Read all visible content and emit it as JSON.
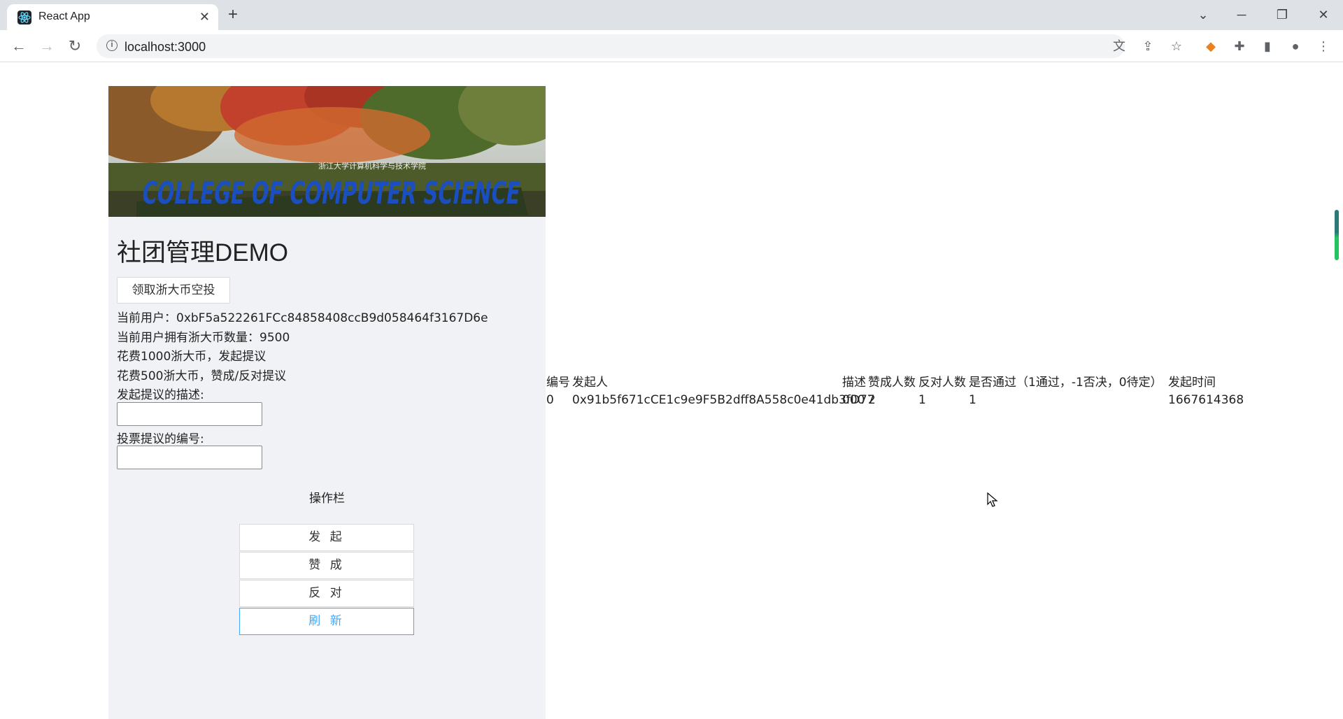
{
  "browser": {
    "tab_title": "React App",
    "url": "localhost:3000"
  },
  "app": {
    "title": "社团管理DEMO",
    "airdrop_button": "领取浙大币空投",
    "current_user": "当前用户：0xbF5a522261FCc84858408ccB9d058464f3167D6e",
    "balance": "当前用户拥有浙大币数量：9500",
    "cost_propose": "花费1000浙大币，发起提议",
    "cost_vote": "花费500浙大币，赞成/反对提议",
    "propose_desc_label": "发起提议的描述:",
    "vote_id_label": "投票提议的编号:",
    "ops_title": "操作栏",
    "buttons": {
      "propose": "发 起",
      "approve": "赞 成",
      "oppose": "反 对",
      "refresh": "刷 新"
    },
    "banner_text": "COLLEGE OF COMPUTER SCIENCE",
    "banner_subtext": "浙江大学计算机科学与技术学院"
  },
  "table": {
    "headers": [
      "编号",
      "发起人",
      "描述",
      "赞成人数",
      "反对人数",
      "是否通过（1通过，-1否决，0待定）",
      "发起时间"
    ],
    "rows": [
      [
        "0",
        "0x91b5f671cCE1c9e9F5B2dff8A558c0e41db3fD77",
        "000",
        "2",
        "1",
        "1",
        "1667614368"
      ]
    ]
  },
  "colors": {
    "panel_bg": "#f0f2f5",
    "accent": "#40a9ff"
  }
}
